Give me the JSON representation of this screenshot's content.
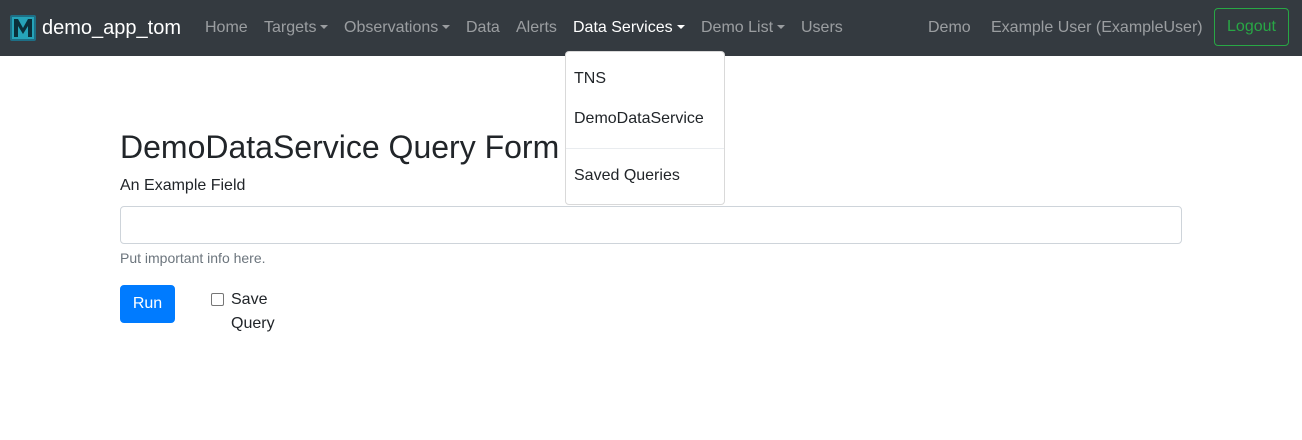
{
  "navbar": {
    "brand": "demo_app_tom",
    "items": [
      {
        "label": "Home"
      },
      {
        "label": "Targets"
      },
      {
        "label": "Observations"
      },
      {
        "label": "Data"
      },
      {
        "label": "Alerts"
      },
      {
        "label": "Data Services"
      },
      {
        "label": "Demo List"
      },
      {
        "label": "Users"
      }
    ],
    "right": {
      "demo": "Demo",
      "user": "Example User (ExampleUser)",
      "logout": "Logout"
    }
  },
  "dropdown": {
    "items": [
      {
        "label": "TNS"
      },
      {
        "label": "DemoDataService"
      },
      {
        "label": "Saved Queries"
      }
    ]
  },
  "form": {
    "title": "DemoDataService Query Form",
    "field_label": "An Example Field",
    "field_value": "",
    "help_text": "Put important info here.",
    "run_label": "Run",
    "save_query_label": "Save Query",
    "save_query_checked": false
  },
  "colors": {
    "navbar_bg": "#343a40",
    "primary": "#007bff",
    "success": "#28a745",
    "logo_teal": "#26a3b8"
  },
  "icons": {
    "brand": "tom-logo-icon",
    "caret": "chevron-down-icon"
  }
}
